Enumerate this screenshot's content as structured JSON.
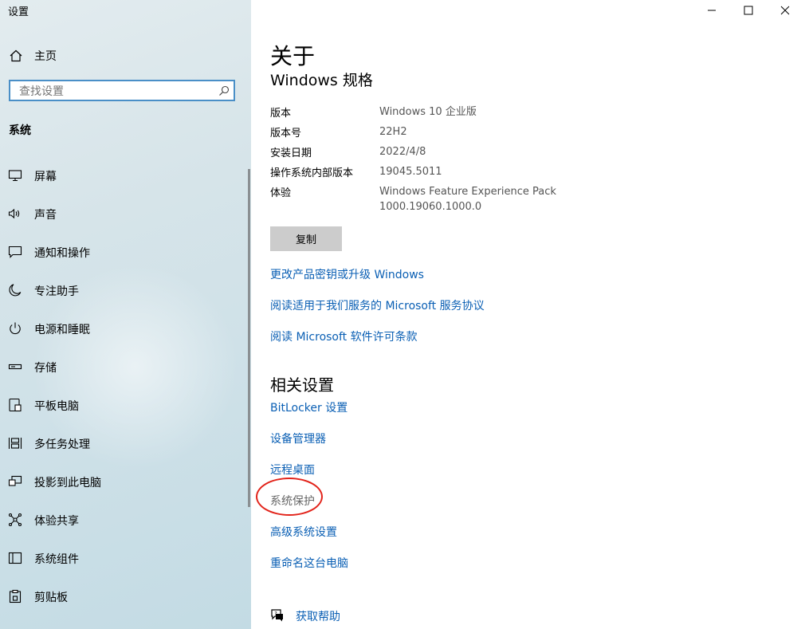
{
  "window": {
    "title": "设置"
  },
  "sidebar": {
    "home_label": "主页",
    "search_placeholder": "查找设置",
    "section_title": "系统",
    "items": [
      {
        "label": "屏幕",
        "icon": "monitor-icon"
      },
      {
        "label": "声音",
        "icon": "speaker-icon"
      },
      {
        "label": "通知和操作",
        "icon": "notification-icon"
      },
      {
        "label": "专注助手",
        "icon": "moon-icon"
      },
      {
        "label": "电源和睡眠",
        "icon": "power-icon"
      },
      {
        "label": "存储",
        "icon": "storage-icon"
      },
      {
        "label": "平板电脑",
        "icon": "tablet-icon"
      },
      {
        "label": "多任务处理",
        "icon": "multitasking-icon"
      },
      {
        "label": "投影到此电脑",
        "icon": "project-icon"
      },
      {
        "label": "体验共享",
        "icon": "share-icon"
      },
      {
        "label": "系统组件",
        "icon": "components-icon"
      },
      {
        "label": "剪贴板",
        "icon": "clipboard-icon"
      }
    ]
  },
  "main": {
    "title": "关于",
    "spec_title": "Windows 规格",
    "specs": [
      {
        "key": "版本",
        "value": "Windows 10 企业版"
      },
      {
        "key": "版本号",
        "value": "22H2"
      },
      {
        "key": "安装日期",
        "value": "2022/4/8"
      },
      {
        "key": "操作系统内部版本",
        "value": "19045.5011"
      },
      {
        "key": "体验",
        "value": "Windows Feature Experience Pack 1000.19060.1000.0"
      }
    ],
    "copy_label": "复制",
    "links": [
      "更改产品密钥或升级 Windows",
      "阅读适用于我们服务的 Microsoft 服务协议",
      "阅读 Microsoft 软件许可条款"
    ],
    "related_title": "相关设置",
    "related_links": [
      "BitLocker 设置",
      "设备管理器",
      "远程桌面"
    ],
    "system_protection": "系统保护",
    "related_links_after": [
      "高级系统设置",
      "重命名这台电脑"
    ],
    "help_label": "获取帮助"
  },
  "colors": {
    "link": "#0a5fb4",
    "search_border": "#4a8fc7",
    "annotation": "#e2231a"
  }
}
